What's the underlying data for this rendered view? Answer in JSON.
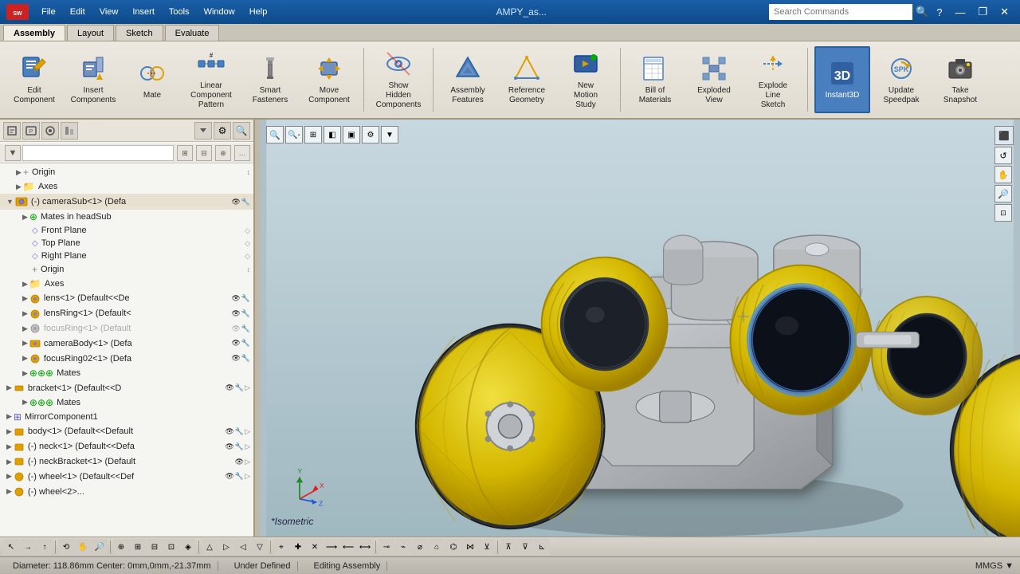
{
  "titlebar": {
    "logo": "SW",
    "menus": [
      "File",
      "Edit",
      "View",
      "Insert",
      "Tools",
      "Window",
      "Help"
    ],
    "filename": "AMPY_as...",
    "search_placeholder": "Search Commands",
    "window_controls": [
      "?",
      "—",
      "□",
      "✕"
    ]
  },
  "ribbon": {
    "tabs": [
      "Assembly",
      "Layout",
      "Sketch",
      "Evaluate"
    ],
    "active_tab": "Assembly",
    "buttons": [
      {
        "id": "edit-component",
        "label": "Edit\nComponent",
        "icon": "✏️",
        "active": false
      },
      {
        "id": "insert-components",
        "label": "Insert\nComponents",
        "icon": "📦",
        "active": false
      },
      {
        "id": "mate",
        "label": "Mate",
        "icon": "🔗",
        "active": false
      },
      {
        "id": "linear-component-pattern",
        "label": "Linear\nComponent\nPattern",
        "icon": "⚙",
        "active": false
      },
      {
        "id": "smart-fasteners",
        "label": "Smart\nFasteners",
        "icon": "🔩",
        "active": false
      },
      {
        "id": "move-component",
        "label": "Move\nComponent",
        "icon": "↔",
        "active": false
      },
      {
        "id": "show-hidden-components",
        "label": "Show\nHidden\nComponents",
        "icon": "👁",
        "active": false
      },
      {
        "id": "assembly-features",
        "label": "Assembly\nFeatures",
        "icon": "◆",
        "active": false
      },
      {
        "id": "reference-geometry",
        "label": "Reference\nGeometry",
        "icon": "△",
        "active": false
      },
      {
        "id": "new-motion-study",
        "label": "New\nMotion\nStudy",
        "icon": "▶",
        "active": false
      },
      {
        "id": "bill-of-materials",
        "label": "Bill of\nMaterials",
        "icon": "📋",
        "active": false
      },
      {
        "id": "exploded-view",
        "label": "Exploded\nView",
        "icon": "💥",
        "active": false
      },
      {
        "id": "explode-line-sketch",
        "label": "Explode\nLine\nSketch",
        "icon": "⟿",
        "active": false
      },
      {
        "id": "instant3d",
        "label": "Instant3D",
        "icon": "3D",
        "active": true
      },
      {
        "id": "update-speedpak",
        "label": "Update\nSpeedpak",
        "icon": "⚡",
        "active": false
      },
      {
        "id": "take-snapshot",
        "label": "Take\nSnapshot",
        "icon": "📷",
        "active": false
      }
    ]
  },
  "feature_tree": {
    "items": [
      {
        "id": "origin",
        "label": "Origin",
        "level": 1,
        "expanded": false,
        "type": "origin",
        "icon": "origin"
      },
      {
        "id": "axes",
        "label": "Axes",
        "level": 1,
        "expanded": false,
        "type": "folder",
        "icon": "folder"
      },
      {
        "id": "camerasub1",
        "label": "(-) cameraSub<1> (Defa",
        "level": 1,
        "expanded": true,
        "type": "component",
        "icon": "component"
      },
      {
        "id": "mates-in-headsub",
        "label": "Mates in headSub",
        "level": 2,
        "expanded": false,
        "type": "mates",
        "icon": "mates"
      },
      {
        "id": "front-plane",
        "label": "Front Plane",
        "level": 3,
        "expanded": false,
        "type": "plane",
        "icon": "plane"
      },
      {
        "id": "top-plane",
        "label": "Top Plane",
        "level": 3,
        "expanded": false,
        "type": "plane",
        "icon": "plane"
      },
      {
        "id": "right-plane",
        "label": "Right Plane",
        "level": 3,
        "expanded": false,
        "type": "plane",
        "icon": "plane"
      },
      {
        "id": "origin2",
        "label": "Origin",
        "level": 3,
        "expanded": false,
        "type": "origin",
        "icon": "origin"
      },
      {
        "id": "axes2",
        "label": "Axes",
        "level": 2,
        "expanded": false,
        "type": "folder",
        "icon": "folder"
      },
      {
        "id": "lens1",
        "label": "lens<1> (Default<<De",
        "level": 2,
        "expanded": false,
        "type": "component",
        "icon": "component"
      },
      {
        "id": "lensring1",
        "label": "lensRing<1> (Default<",
        "level": 2,
        "expanded": false,
        "type": "component",
        "icon": "component"
      },
      {
        "id": "focusring1",
        "label": "focusRing<1> (Default",
        "level": 2,
        "expanded": false,
        "type": "component-gray",
        "icon": "component-gray"
      },
      {
        "id": "camerabody1",
        "label": "cameraBody<1> (Defa",
        "level": 2,
        "expanded": false,
        "type": "component",
        "icon": "component"
      },
      {
        "id": "focusring02",
        "label": "focusRing02<1> (Defa",
        "level": 2,
        "expanded": false,
        "type": "component",
        "icon": "component"
      },
      {
        "id": "mates2",
        "label": "Mates",
        "level": 2,
        "expanded": false,
        "type": "mates",
        "icon": "mates"
      },
      {
        "id": "bracket1",
        "label": "bracket<1> (Default<<D",
        "level": 1,
        "expanded": false,
        "type": "component",
        "icon": "component"
      },
      {
        "id": "mates3",
        "label": "Mates",
        "level": 2,
        "expanded": false,
        "type": "mates",
        "icon": "mates"
      },
      {
        "id": "mirrorcomponent1",
        "label": "MirrorComponent1",
        "level": 1,
        "expanded": false,
        "type": "mirror",
        "icon": "mirror"
      },
      {
        "id": "body1",
        "label": "body<1> (Default<<Default",
        "level": 1,
        "expanded": false,
        "type": "component",
        "icon": "component"
      },
      {
        "id": "neck1",
        "label": "(-) neck<1> (Default<<Defa",
        "level": 1,
        "expanded": false,
        "type": "component",
        "icon": "component"
      },
      {
        "id": "neckbracket1",
        "label": "(-) neckBracket<1> (Default",
        "level": 1,
        "expanded": false,
        "type": "component",
        "icon": "component"
      },
      {
        "id": "wheel1",
        "label": "(-) wheel<1> (Default<<Def",
        "level": 1,
        "expanded": false,
        "type": "component",
        "icon": "component"
      },
      {
        "id": "wheel2",
        "label": "(-) wheel<2>...",
        "level": 1,
        "expanded": false,
        "type": "component",
        "icon": "component"
      }
    ]
  },
  "viewport": {
    "isometric_label": "*Isometric",
    "axis_labels": {
      "x": "X",
      "y": "Y",
      "z": "Z"
    }
  },
  "statusbar": {
    "info": "Diameter: 118.86mm  Center: 0mm,0mm,-21.37mm",
    "state": "Under Defined",
    "mode": "Editing Assembly",
    "units": "MMGS"
  },
  "bottom_tools": [
    "↖",
    "→",
    "↑",
    "⟲",
    "⭮",
    "↔",
    "⤢",
    "⚙",
    "△",
    "⊕",
    "✕",
    "⊞",
    "⊟",
    "⊡",
    "⊠",
    "⊛",
    "⊜",
    "⊝",
    "⊞",
    "⊟",
    "⊡",
    "⊠",
    "⊛",
    "⊜",
    "⊝"
  ]
}
